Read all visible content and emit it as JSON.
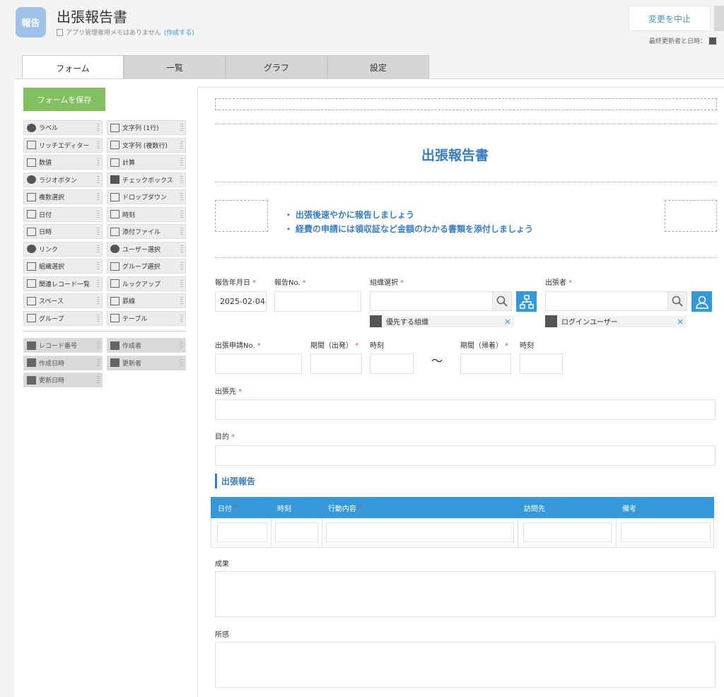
{
  "header": {
    "app_icon_text": "報告",
    "title": "出張報告書",
    "memo_text": "アプリ管理者用メモはありません",
    "memo_link": "(作成する)",
    "cancel_label": "変更を中止",
    "updated_label": "最終更新者と日時："
  },
  "tabs": [
    "フォーム",
    "一覧",
    "グラフ",
    "設定"
  ],
  "palette": {
    "save_label": "フォームを保存",
    "items": [
      "ラベル",
      "文字列 (1行)",
      "リッチエディター",
      "文字列 (複数行)",
      "数値",
      "計算",
      "ラジオボタン",
      "チェックボックス",
      "複数選択",
      "ドロップダウン",
      "日付",
      "時刻",
      "日時",
      "添付ファイル",
      "リンク",
      "ユーザー選択",
      "組織選択",
      "グループ選択",
      "関連レコード一覧",
      "ルックアップ",
      "スペース",
      "罫線",
      "グループ",
      "テーブル"
    ],
    "system_items": [
      "レコード番号",
      "作成者",
      "作成日時",
      "更新者",
      "更新日時"
    ]
  },
  "form": {
    "title": "出張報告書",
    "notes": [
      "出張後速やかに報告しましょう",
      "経費の申請には領収証など金額のわかる書類を添付しましょう"
    ],
    "report_date_label": "報告年月日",
    "report_date_value": "2025-02-04",
    "report_no_label": "報告No.",
    "org_label": "組織選択",
    "org_chip": "優先する組織",
    "traveler_label": "出張者",
    "traveler_chip": "ログインユーザー",
    "app_no_label": "出張申請No.",
    "depart_label": "期間（出発）",
    "depart_time_label": "時刻",
    "tilde": "～",
    "return_label": "期間（帰着）",
    "return_time_label": "時刻",
    "dest_label": "出張先",
    "purpose_label": "目的",
    "section_title": "出張報告",
    "table_headers": [
      "日付",
      "時刻",
      "行動内容",
      "訪問先",
      "備考"
    ],
    "result_label": "成果",
    "impression_label": "所感",
    "required_mark": "*",
    "clear_mark": "×"
  },
  "colors": {
    "accent": "#3498db",
    "save_green": "#81bf5f",
    "required": "#e74c3c"
  }
}
